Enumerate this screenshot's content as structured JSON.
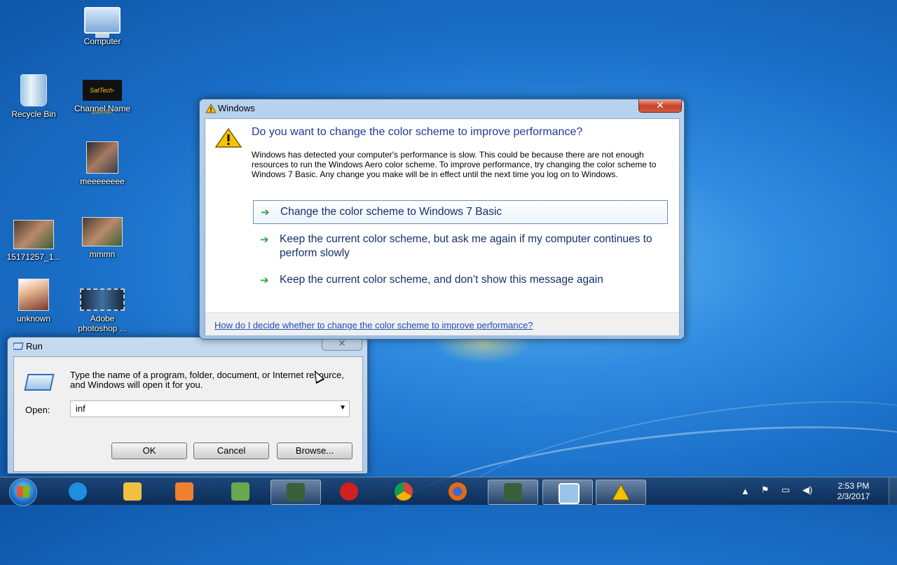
{
  "desktop": {
    "icons": [
      {
        "label": "Computer",
        "icon": "computer-icon"
      },
      {
        "label": "Recycle Bin",
        "icon": "recycle-bin-icon"
      },
      {
        "label": "Channel Name",
        "icon": "channel-thumbnail-icon",
        "thumb_text": "SatTech-Bastion"
      },
      {
        "label": "meeeeeeee",
        "icon": "photo-icon"
      },
      {
        "label": "15171257_1...",
        "icon": "photo-icon"
      },
      {
        "label": "mmmn",
        "icon": "photo-icon"
      },
      {
        "label": "unknown",
        "icon": "photo-icon"
      },
      {
        "label": "Adobe photoshop ...",
        "icon": "video-file-icon"
      }
    ]
  },
  "color_dialog": {
    "title": "Windows",
    "close_glyph": "✕",
    "instruction": "Do you want to change the color scheme to improve performance?",
    "body": "Windows has detected your computer's performance is slow. This could be because there are not enough resources to run the Windows Aero color scheme. To improve performance, try changing the color scheme to Windows 7 Basic. Any change you make will be in effect until the next time you log on to Windows.",
    "commands": [
      {
        "label": "Change the color scheme to Windows 7 Basic"
      },
      {
        "label": "Keep the current color scheme, but ask me again if my computer continues to perform slowly"
      },
      {
        "label": "Keep the current color scheme, and don’t show this message again"
      }
    ],
    "help_link": "How do I decide whether to change the color scheme to improve performance?",
    "arrow_glyph": "➔"
  },
  "run_dialog": {
    "title": "Run",
    "close_glyph": "✕",
    "description": "Type the name of a program, folder, document, or Internet resource, and Windows will open it for you.",
    "open_label": "Open:",
    "open_value": "inf",
    "ok_label": "OK",
    "cancel_label": "Cancel",
    "browse_label": "Browse..."
  },
  "taskbar": {
    "items": [
      {
        "name": "internet-explorer",
        "color": "#1e8fe0"
      },
      {
        "name": "file-explorer",
        "color": "#f0c040"
      },
      {
        "name": "media-player",
        "color": "#f08030"
      },
      {
        "name": "paint-app",
        "color": "#6aa84f"
      },
      {
        "name": "cmd-app",
        "color": "#3b5f3a"
      },
      {
        "name": "download-app",
        "color": "#d02020"
      },
      {
        "name": "chrome",
        "color": "#e8b800"
      },
      {
        "name": "firefox",
        "color": "#e86a10"
      },
      {
        "name": "cmd-app-2",
        "color": "#3b5f3a"
      },
      {
        "name": "run-app",
        "color": "#9cc3e8"
      },
      {
        "name": "warning-app",
        "color": "#f2c200"
      }
    ],
    "time": "2:53 PM",
    "date": "2/3/2017"
  }
}
